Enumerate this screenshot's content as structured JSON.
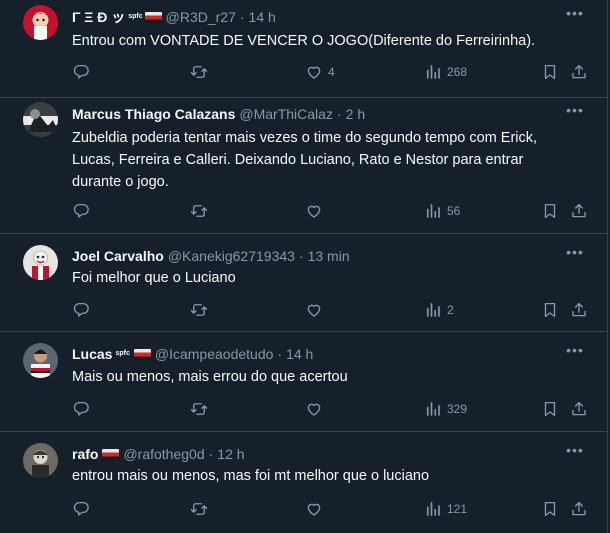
{
  "tweets": [
    {
      "name": "Γ Ξ Ð ッ",
      "badge": "spfc",
      "handle": "@R3D_r27",
      "time": "14 h",
      "text": "Entrou com VONTADE DE VENCER O JOGO(Diferente do Ferreirinha).",
      "likes": "4",
      "views": "268"
    },
    {
      "name": "Marcus Thiago Calazans",
      "handle": "@MarThiCalaz",
      "time": "2 h",
      "text": "Zubeldia poderia tentar mais vezes o time do segundo tempo com Erick, Lucas, Ferreira e Calleri. Deixando Luciano, Rato e Nestor para entrar durante o jogo.",
      "likes": "",
      "views": "56"
    },
    {
      "name": "Joel Carvalho",
      "handle": "@Kanekig62719343",
      "time": "13 min",
      "text": "Foi melhor que o Luciano",
      "likes": "",
      "views": "2"
    },
    {
      "name": "Lucas",
      "badge": "spfc",
      "handle": "@Icampeaodetudo",
      "time": "14 h",
      "text": "Mais ou menos, mais errou do que acertou",
      "likes": "",
      "views": "329"
    },
    {
      "name": "rafo",
      "handle": "@rafotheg0d",
      "time": "12 h",
      "text": "entrou mais ou menos, mas foi mt melhor que o luciano",
      "likes": "",
      "views": "121"
    }
  ],
  "separator": "·",
  "colors": {
    "background": "#15202b",
    "border": "#38444d",
    "text": "#f7f9f9",
    "muted": "#8b98a5"
  },
  "icons": [
    "reply-icon",
    "retweet-icon",
    "like-icon",
    "views-icon",
    "bookmark-icon",
    "share-icon",
    "more-icon"
  ]
}
